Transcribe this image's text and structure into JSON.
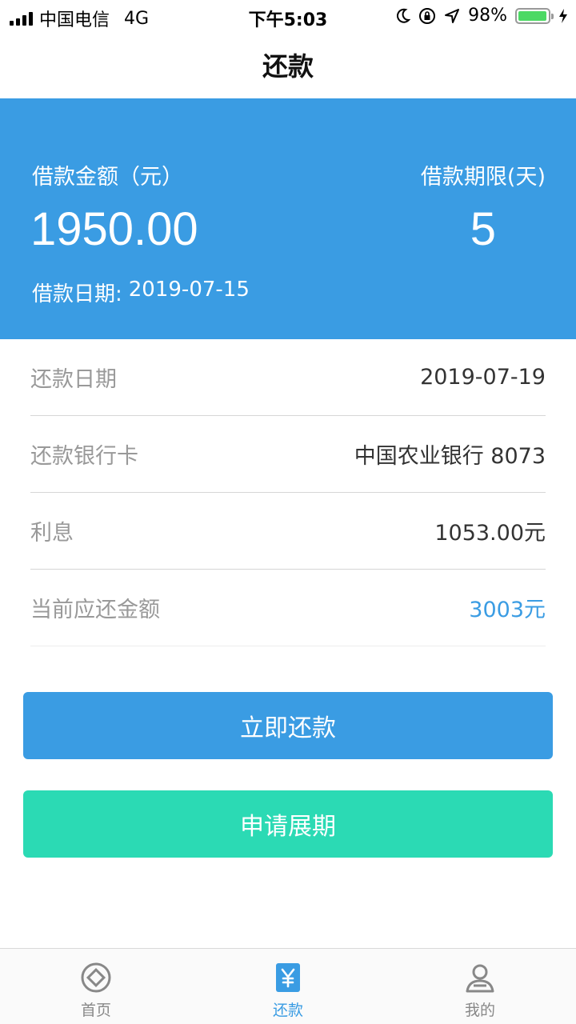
{
  "status_bar": {
    "carrier": "中国电信",
    "network": "4G",
    "time": "下午5:03",
    "battery_percent": "98%",
    "battery_level": 0.98
  },
  "nav": {
    "title": "还款"
  },
  "loan": {
    "amount_label": "借款金额（元）",
    "amount_value": "1950.00",
    "term_label": "借款期限(天)",
    "term_value": "5",
    "date_label": "借款日期:",
    "date_value": "2019-07-15"
  },
  "details": [
    {
      "label": "还款日期",
      "value": "2019-07-19",
      "accent": false
    },
    {
      "label": "还款银行卡",
      "value": "中国农业银行 8073",
      "accent": false
    },
    {
      "label": "利息",
      "value": "1053.00元",
      "accent": false
    },
    {
      "label": "当前应还金额",
      "value": "3003元",
      "accent": true
    }
  ],
  "buttons": {
    "repay": "立即还款",
    "extend": "申请展期"
  },
  "tabs": [
    {
      "label": "首页",
      "icon": "home-icon",
      "active": false
    },
    {
      "label": "还款",
      "icon": "yen-icon",
      "active": true
    },
    {
      "label": "我的",
      "icon": "user-icon",
      "active": false
    }
  ],
  "colors": {
    "primary": "#3a9ce3",
    "secondary": "#2bdab4",
    "battery": "#4cd964"
  }
}
